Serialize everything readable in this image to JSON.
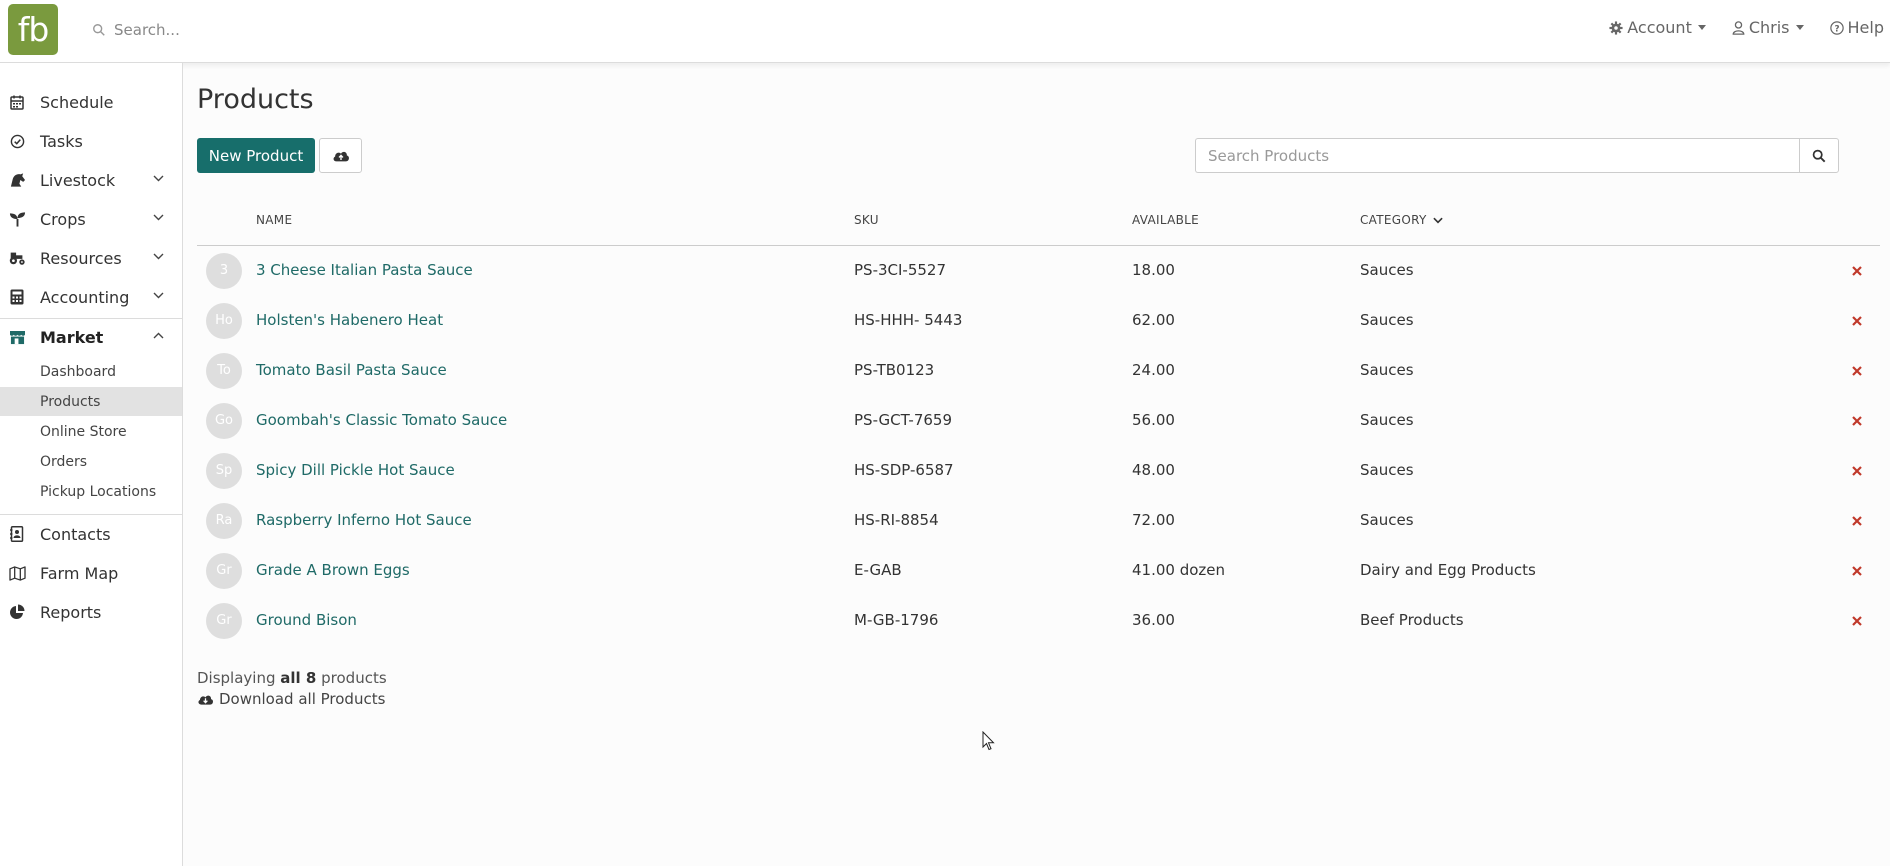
{
  "brand": {
    "logo_text": "fb",
    "logo_color": "#7a9a3e"
  },
  "topbar": {
    "search_placeholder": "Search...",
    "account_label": "Account",
    "user_label": "Chris",
    "help_label": "Help"
  },
  "sidebar": {
    "items": [
      {
        "label": "Schedule",
        "icon": "calendar-icon"
      },
      {
        "label": "Tasks",
        "icon": "check-circle-icon"
      },
      {
        "label": "Livestock",
        "icon": "horse-icon",
        "expandable": true
      },
      {
        "label": "Crops",
        "icon": "seedling-icon",
        "expandable": true
      },
      {
        "label": "Resources",
        "icon": "tractor-icon",
        "expandable": true
      },
      {
        "label": "Accounting",
        "icon": "calculator-icon",
        "expandable": true
      },
      {
        "label": "Market",
        "icon": "store-icon",
        "expanded": true
      },
      {
        "label": "Contacts",
        "icon": "address-book-icon"
      },
      {
        "label": "Farm Map",
        "icon": "map-icon"
      },
      {
        "label": "Reports",
        "icon": "pie-chart-icon"
      }
    ],
    "market_subitems": [
      {
        "label": "Dashboard"
      },
      {
        "label": "Products",
        "selected": true
      },
      {
        "label": "Online Store"
      },
      {
        "label": "Orders"
      },
      {
        "label": "Pickup Locations"
      }
    ]
  },
  "main": {
    "title": "Products",
    "new_button": "New Product",
    "search_placeholder": "Search Products",
    "columns": {
      "name": "NAME",
      "sku": "SKU",
      "available": "AVAILABLE",
      "category": "CATEGORY"
    },
    "rows": [
      {
        "avatar": "3",
        "name": "3 Cheese Italian Pasta Sauce",
        "sku": "PS-3CI-5527",
        "available": "18.00",
        "category": "Sauces"
      },
      {
        "avatar": "Ho",
        "name": "Holsten's Habenero Heat",
        "sku": "HS-HHH- 5443",
        "available": "62.00",
        "category": "Sauces"
      },
      {
        "avatar": "To",
        "name": "Tomato Basil Pasta Sauce",
        "sku": "PS-TB0123",
        "available": "24.00",
        "category": "Sauces"
      },
      {
        "avatar": "Go",
        "name": "Goombah's Classic Tomato Sauce",
        "sku": "PS-GCT-7659",
        "available": "56.00",
        "category": "Sauces"
      },
      {
        "avatar": "Sp",
        "name": "Spicy Dill Pickle Hot Sauce",
        "sku": "HS-SDP-6587",
        "available": "48.00",
        "category": "Sauces"
      },
      {
        "avatar": "Ra",
        "name": "Raspberry Inferno Hot Sauce",
        "sku": "HS-RI-8854",
        "available": "72.00",
        "category": "Sauces"
      },
      {
        "avatar": "Gr",
        "name": "Grade A Brown Eggs",
        "sku": "E-GAB",
        "available": "41.00 dozen",
        "category": "Dairy and Egg Products"
      },
      {
        "avatar": "Gr",
        "name": "Ground Bison",
        "sku": "M-GB-1796",
        "available": "36.00",
        "category": "Beef Products"
      }
    ],
    "footer": {
      "prefix": "Displaying",
      "count_text": "all 8",
      "suffix": "products",
      "download_label": "Download all Products"
    }
  },
  "colors": {
    "primary": "#176e6b",
    "link": "#1f6a67",
    "delete": "#c0392b"
  }
}
